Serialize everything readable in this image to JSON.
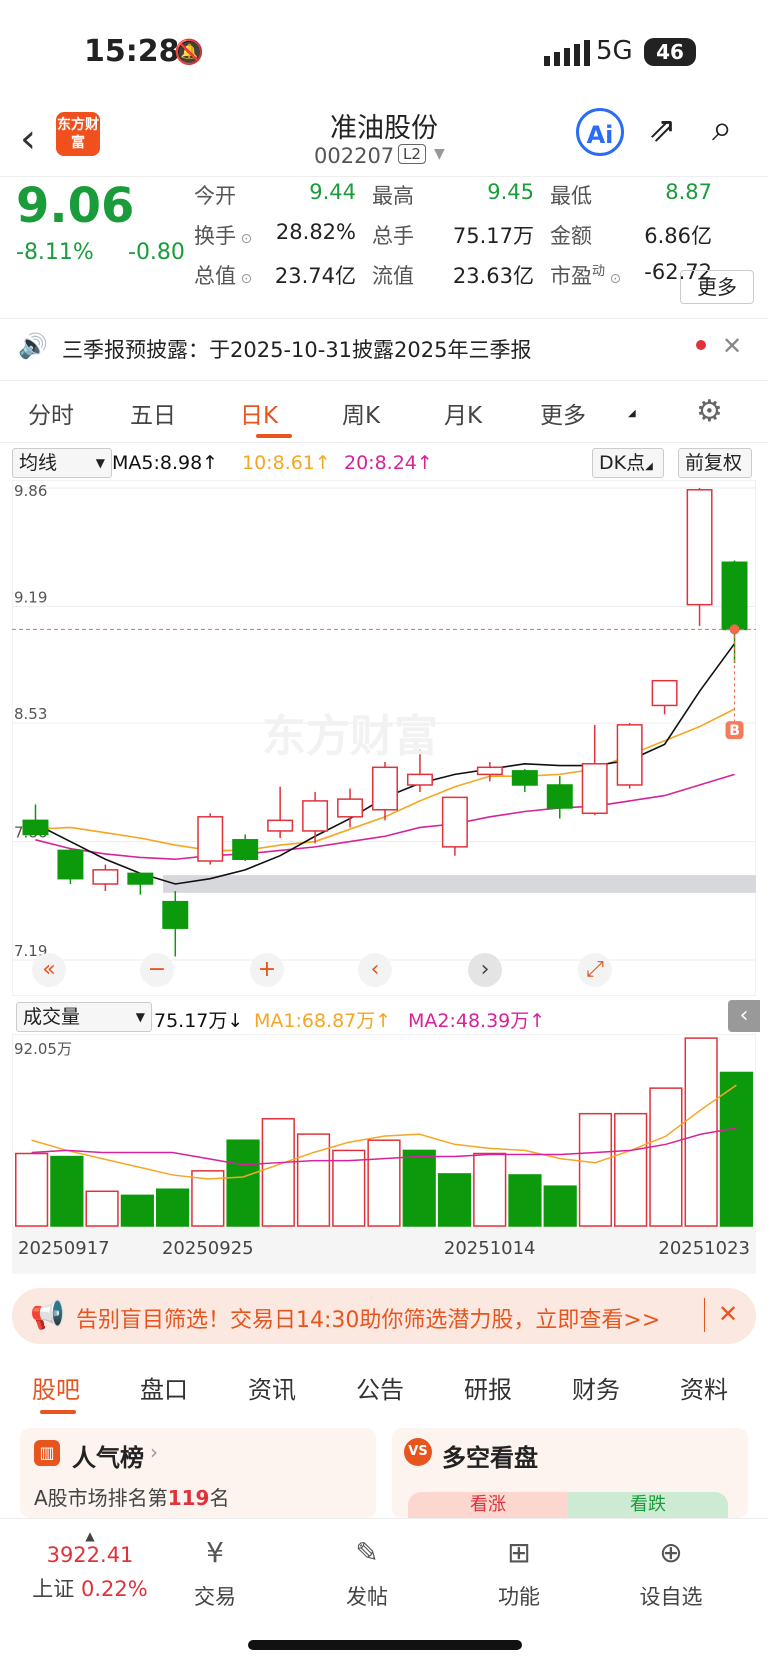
{
  "status": {
    "time": "15:28",
    "network": "5G",
    "battery": "46"
  },
  "header": {
    "name": "准油股份",
    "code": "002207",
    "level": "L2",
    "logo": "东方财富",
    "ai": "Ai"
  },
  "quote": {
    "price": "9.06",
    "pct": "-8.11%",
    "change": "-0.80",
    "fields": [
      {
        "label": "今开",
        "value": "9.44",
        "value_color": "#1a9c3a"
      },
      {
        "label": "最高",
        "value": "9.45",
        "value_color": "#1a9c3a"
      },
      {
        "label": "最低",
        "value": "8.87",
        "value_color": "#1a9c3a"
      },
      {
        "label": "换手",
        "value": "28.82%",
        "value_color": "#222222"
      },
      {
        "label": "总手",
        "value": "75.17万",
        "value_color": "#222222"
      },
      {
        "label": "金额",
        "value": "6.86亿",
        "value_color": "#222222"
      },
      {
        "label": "总值",
        "value": "23.74亿",
        "value_color": "#222222"
      },
      {
        "label": "流值",
        "value": "23.63亿",
        "value_color": "#222222"
      },
      {
        "label": "市盈",
        "value": "-62.72",
        "value_color": "#222222"
      }
    ],
    "pe_sup": "动",
    "more": "更多"
  },
  "notice": "三季报预披露：于2025-10-31披露2025年三季报",
  "tabs": {
    "items": [
      "分时",
      "五日",
      "日K",
      "周K",
      "月K",
      "更多"
    ],
    "active": 2
  },
  "ma_bar": {
    "select": "均线",
    "ma5": "MA5:8.98↑",
    "ma10": "10:8.61↑",
    "ma20": "20:8.24↑",
    "dk": "DK点",
    "adjust": "前复权"
  },
  "vol_bar": {
    "select": "成交量",
    "vol": "75.17万↓",
    "ma1": "MA1:68.87万↑",
    "ma2": "MA2:48.39万↑"
  },
  "watermark": "东方财富",
  "chart_data": [
    {
      "type": "candlestick",
      "title": "日K",
      "yticks": [
        "9.86",
        "9.19",
        "8.53",
        "7.86",
        "7.19"
      ],
      "ylim": [
        7.19,
        9.86
      ],
      "current_price": 9.06,
      "marker": "B",
      "colors": {
        "up": "#e0323a",
        "down": "#0c9a0c",
        "ma5": "#111111",
        "ma10": "#f5a623",
        "ma20": "#d6239b"
      },
      "candles": [
        {
          "o": 7.98,
          "h": 8.07,
          "l": 7.92,
          "c": 7.9
        },
        {
          "o": 7.81,
          "h": 7.82,
          "l": 7.62,
          "c": 7.65
        },
        {
          "o": 7.62,
          "h": 7.73,
          "l": 7.58,
          "c": 7.7
        },
        {
          "o": 7.68,
          "h": 7.68,
          "l": 7.56,
          "c": 7.62
        },
        {
          "o": 7.52,
          "h": 7.58,
          "l": 7.21,
          "c": 7.37
        },
        {
          "o": 7.75,
          "h": 8.02,
          "l": 7.73,
          "c": 8.0
        },
        {
          "o": 7.87,
          "h": 7.9,
          "l": 7.75,
          "c": 7.76
        },
        {
          "o": 7.92,
          "h": 8.17,
          "l": 7.88,
          "c": 7.98
        },
        {
          "o": 7.92,
          "h": 8.14,
          "l": 7.85,
          "c": 8.09
        },
        {
          "o": 8.0,
          "h": 8.16,
          "l": 7.94,
          "c": 8.1
        },
        {
          "o": 8.04,
          "h": 8.31,
          "l": 7.98,
          "c": 8.28
        },
        {
          "o": 8.18,
          "h": 8.38,
          "l": 8.14,
          "c": 8.24
        },
        {
          "o": 7.83,
          "h": 8.11,
          "l": 7.78,
          "c": 8.11
        },
        {
          "o": 8.24,
          "h": 8.31,
          "l": 8.2,
          "c": 8.28
        },
        {
          "o": 8.26,
          "h": 8.27,
          "l": 8.14,
          "c": 8.18
        },
        {
          "o": 8.18,
          "h": 8.23,
          "l": 7.99,
          "c": 8.05
        },
        {
          "o": 8.02,
          "h": 8.52,
          "l": 8.01,
          "c": 8.3
        },
        {
          "o": 8.18,
          "h": 8.53,
          "l": 8.16,
          "c": 8.52
        },
        {
          "o": 8.63,
          "h": 8.75,
          "l": 8.58,
          "c": 8.77
        },
        {
          "o": 9.2,
          "h": 9.86,
          "l": 9.08,
          "c": 9.85
        },
        {
          "o": 9.44,
          "h": 9.45,
          "l": 8.87,
          "c": 9.06
        }
      ],
      "ma5": [
        7.96,
        7.86,
        7.76,
        7.68,
        7.62,
        7.65,
        7.7,
        7.78,
        7.89,
        7.99,
        8.11,
        8.19,
        8.24,
        8.27,
        8.3,
        8.29,
        8.29,
        8.32,
        8.41,
        8.71,
        8.98
      ],
      "ma10": [
        7.93,
        7.94,
        7.91,
        7.88,
        7.84,
        7.81,
        7.81,
        7.84,
        7.86,
        7.93,
        8.0,
        8.09,
        8.17,
        8.23,
        8.23,
        8.24,
        8.27,
        8.35,
        8.43,
        8.51,
        8.61
      ],
      "ma20": [
        7.87,
        7.82,
        7.79,
        7.77,
        7.76,
        7.78,
        7.79,
        7.81,
        7.83,
        7.86,
        7.89,
        7.94,
        7.96,
        8.0,
        8.03,
        8.05,
        8.06,
        8.09,
        8.12,
        8.18,
        8.24
      ]
    },
    {
      "type": "bar",
      "title": "成交量",
      "ylabel_top": "92.05万",
      "ylim": [
        0,
        92.05
      ],
      "categories": [
        "20250917",
        "",
        "",
        "",
        "",
        "20250925",
        "",
        "",
        "",
        "",
        "",
        "",
        "",
        "20251014",
        "",
        "",
        "",
        "",
        "",
        "20251023",
        ""
      ],
      "xticks": [
        "20250917",
        "20250925",
        "20251014",
        "20251023"
      ],
      "values": [
        35.5,
        34.0,
        17.0,
        15.0,
        18.0,
        27.0,
        42.0,
        52.5,
        45.0,
        37.0,
        42.0,
        37.0,
        25.5,
        35.5,
        25.0,
        19.5,
        55.0,
        55.0,
        67.5,
        92.0,
        75.17
      ],
      "up": [
        true,
        false,
        true,
        false,
        false,
        true,
        false,
        true,
        true,
        true,
        true,
        false,
        false,
        true,
        false,
        false,
        true,
        true,
        true,
        true,
        false
      ],
      "ma1": [
        42,
        37,
        33,
        29,
        25,
        23,
        24,
        30,
        36,
        41,
        44,
        45,
        40,
        38,
        37,
        33,
        31,
        37,
        44,
        57,
        69
      ],
      "ma2": [
        36,
        37,
        36,
        36,
        36,
        33,
        30,
        31,
        32,
        32,
        33,
        34,
        34,
        35,
        35,
        35,
        36,
        37,
        40,
        45,
        48
      ]
    }
  ],
  "chart_controls": [
    "«",
    "−",
    "+",
    "‹",
    "›",
    "⤢"
  ],
  "promo": "告别盲目筛选！交易日14:30助你筛选潜力股，立即查看>>",
  "bottom_tabs": {
    "items": [
      "股吧",
      "盘口",
      "资讯",
      "公告",
      "研报",
      "财务",
      "资料"
    ],
    "active": 0
  },
  "cards": [
    {
      "title": "人气榜",
      "sub_pre": "A股市场排名第",
      "rank": "119",
      "sub_post": "名"
    },
    {
      "title": "多空看盘",
      "bull": "看涨",
      "bear": "看跌"
    }
  ],
  "navbar": {
    "index_value": "3922.41",
    "index_name": "上证",
    "index_pct": "0.22%",
    "items": [
      {
        "label": "交易",
        "icon": "trade-icon"
      },
      {
        "label": "发帖",
        "icon": "post-icon"
      },
      {
        "label": "功能",
        "icon": "apps-icon"
      },
      {
        "label": "设自选",
        "icon": "add-watchlist-icon"
      }
    ]
  }
}
